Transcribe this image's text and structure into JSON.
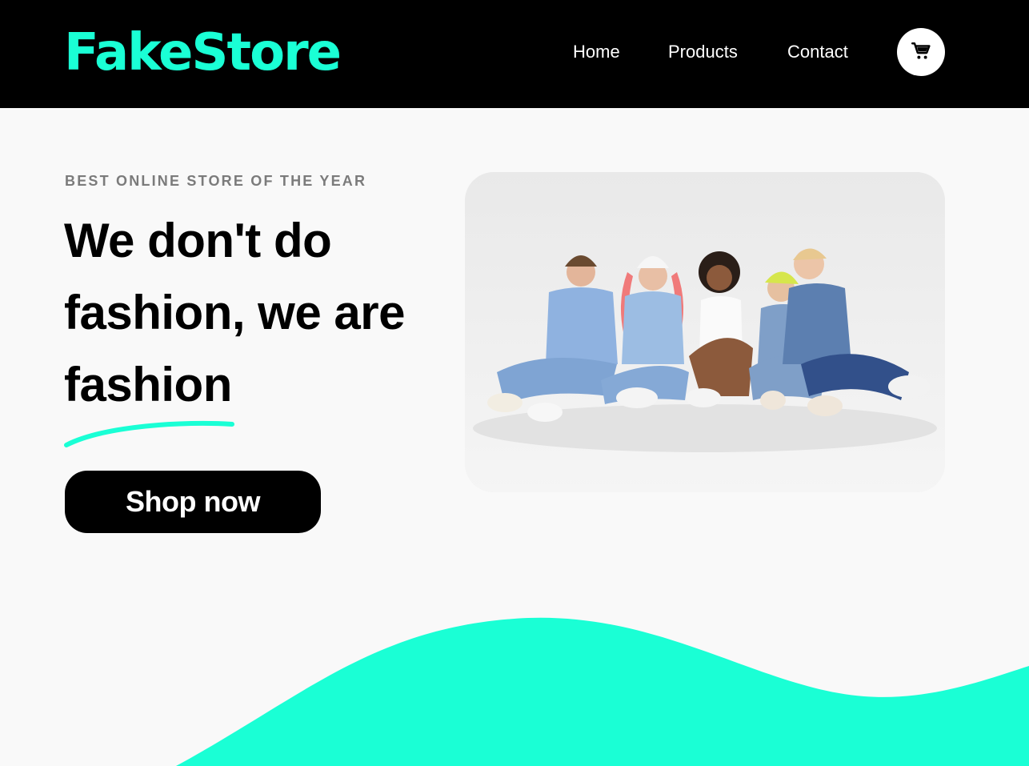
{
  "brand": {
    "name": "FakeStore",
    "color": "#1affd5"
  },
  "nav": {
    "items": [
      {
        "label": "Home"
      },
      {
        "label": "Products"
      },
      {
        "label": "Contact"
      }
    ],
    "cart_icon": "shopping-cart-icon"
  },
  "hero": {
    "eyebrow": "BEST ONLINE STORE OF THE YEAR",
    "headline_line1": "We don't do",
    "headline_line2": "fashion, we are",
    "headline_line3": "fashion",
    "cta_label": "Shop now",
    "accent_color": "#1affd5"
  }
}
